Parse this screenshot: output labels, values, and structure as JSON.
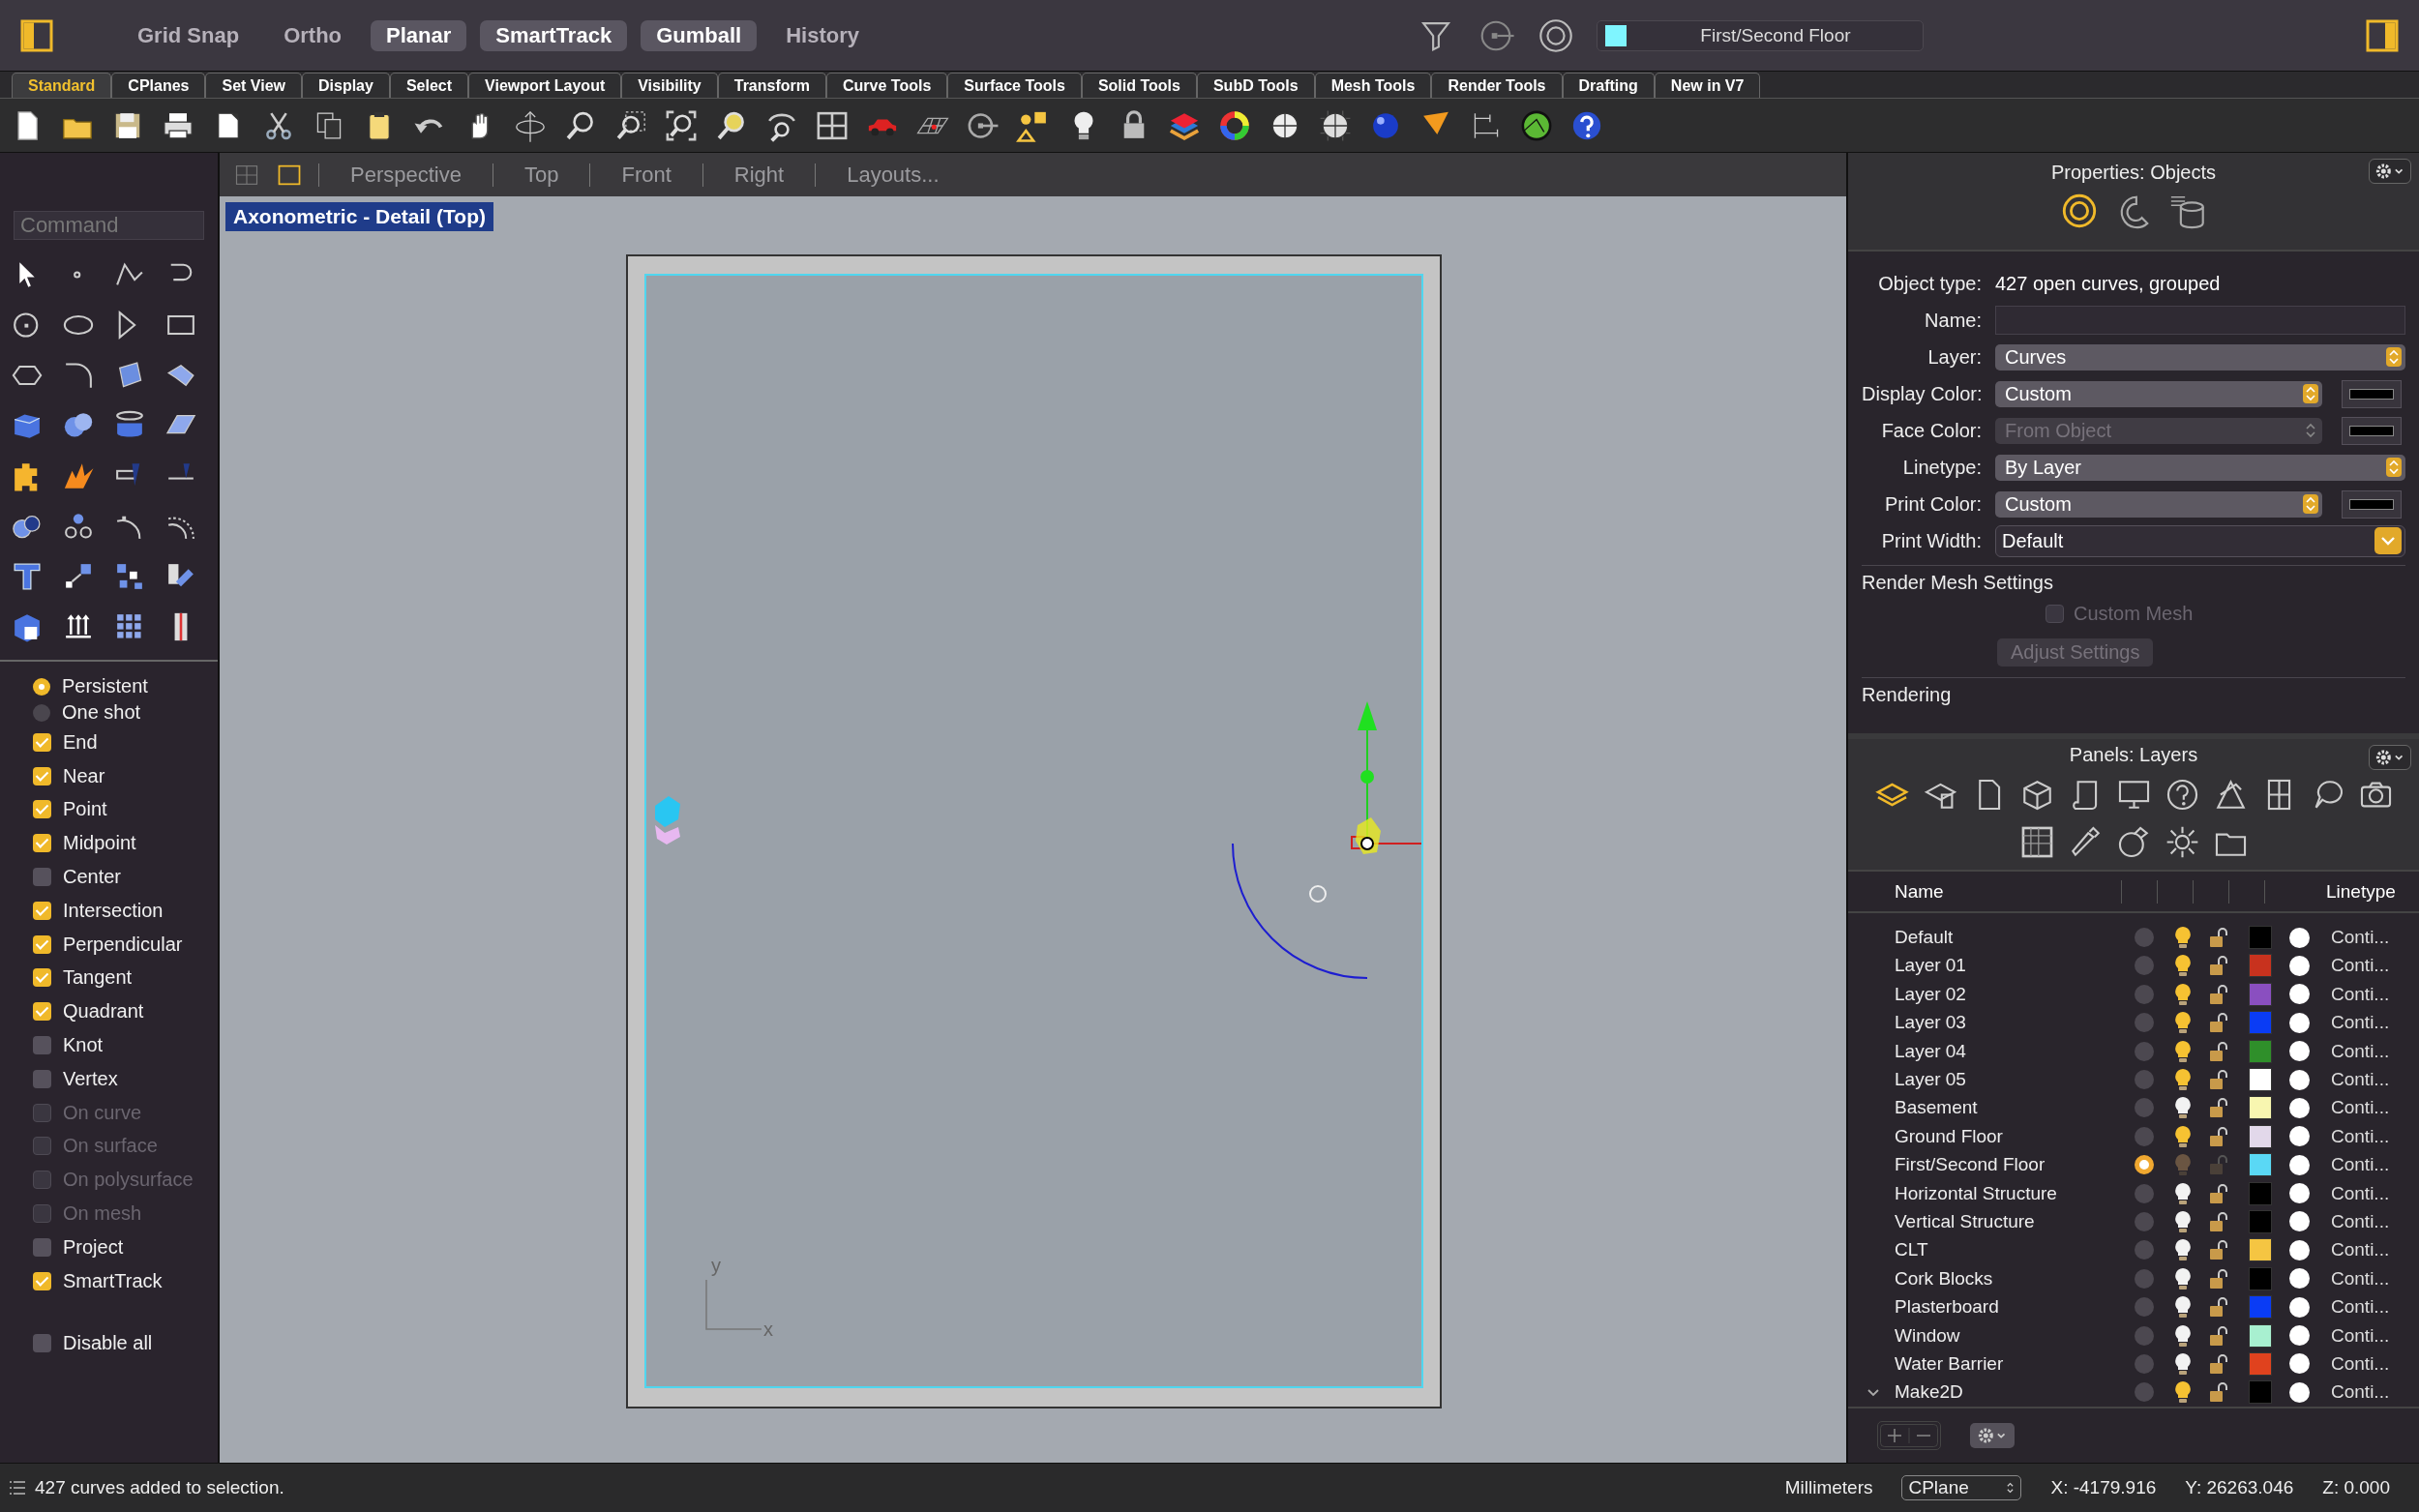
{
  "top_bar": {
    "toggles": [
      {
        "label": "Grid Snap",
        "on": false
      },
      {
        "label": "Ortho",
        "on": false
      },
      {
        "label": "Planar",
        "on": true
      },
      {
        "label": "SmartTrack",
        "on": true
      },
      {
        "label": "Gumball",
        "on": true
      },
      {
        "label": "History",
        "on": false
      }
    ],
    "current_layer": {
      "name": "First/Second Floor",
      "color": "#7ff5ff"
    }
  },
  "toolbar_tabs": [
    {
      "label": "Standard",
      "selected": true
    },
    {
      "label": "CPlanes",
      "selected": false
    },
    {
      "label": "Set View",
      "selected": false
    },
    {
      "label": "Display",
      "selected": false
    },
    {
      "label": "Select",
      "selected": false
    },
    {
      "label": "Viewport Layout",
      "selected": false
    },
    {
      "label": "Visibility",
      "selected": false
    },
    {
      "label": "Transform",
      "selected": false
    },
    {
      "label": "Curve Tools",
      "selected": false
    },
    {
      "label": "Surface Tools",
      "selected": false
    },
    {
      "label": "Solid Tools",
      "selected": false
    },
    {
      "label": "SubD Tools",
      "selected": false
    },
    {
      "label": "Mesh Tools",
      "selected": false
    },
    {
      "label": "Render Tools",
      "selected": false
    },
    {
      "label": "Drafting",
      "selected": false
    },
    {
      "label": "New in V7",
      "selected": false
    }
  ],
  "command": {
    "placeholder": "Command"
  },
  "osnap": {
    "modes": [
      {
        "label": "Persistent",
        "selected": true
      },
      {
        "label": "One shot",
        "selected": false
      }
    ],
    "snaps": [
      {
        "label": "End",
        "checked": true,
        "disabled": false
      },
      {
        "label": "Near",
        "checked": true,
        "disabled": false
      },
      {
        "label": "Point",
        "checked": true,
        "disabled": false
      },
      {
        "label": "Midpoint",
        "checked": true,
        "disabled": false
      },
      {
        "label": "Center",
        "checked": false,
        "disabled": false
      },
      {
        "label": "Intersection",
        "checked": true,
        "disabled": false
      },
      {
        "label": "Perpendicular",
        "checked": true,
        "disabled": false
      },
      {
        "label": "Tangent",
        "checked": true,
        "disabled": false
      },
      {
        "label": "Quadrant",
        "checked": true,
        "disabled": false
      },
      {
        "label": "Knot",
        "checked": false,
        "disabled": false
      },
      {
        "label": "Vertex",
        "checked": false,
        "disabled": false
      },
      {
        "label": "On curve",
        "checked": false,
        "disabled": true
      },
      {
        "label": "On surface",
        "checked": false,
        "disabled": true
      },
      {
        "label": "On polysurface",
        "checked": false,
        "disabled": true
      },
      {
        "label": "On mesh",
        "checked": false,
        "disabled": true
      },
      {
        "label": "Project",
        "checked": false,
        "disabled": false
      },
      {
        "label": "SmartTrack",
        "checked": true,
        "disabled": false
      }
    ],
    "disable_all": {
      "label": "Disable all",
      "checked": false
    }
  },
  "viewport": {
    "tabs": [
      "Perspective",
      "Top",
      "Front",
      "Right",
      "Layouts..."
    ],
    "title": "Axonometric - Detail (Top)",
    "axis": {
      "y": "y",
      "x": "x"
    }
  },
  "properties": {
    "title": "Properties: Objects",
    "object_type": {
      "label": "Object type:",
      "value": "427 open curves, grouped"
    },
    "fields": [
      {
        "kind": "input",
        "label": "Name:"
      },
      {
        "kind": "select",
        "label": "Layer:",
        "value": "Curves",
        "disabled": false,
        "swatch": false
      },
      {
        "kind": "select",
        "label": "Display Color:",
        "value": "Custom",
        "disabled": false,
        "swatch": true
      },
      {
        "kind": "select",
        "label": "Face Color:",
        "value": "From Object",
        "disabled": true,
        "swatch": true
      },
      {
        "kind": "select",
        "label": "Linetype:",
        "value": "By Layer",
        "disabled": false,
        "swatch": false
      },
      {
        "kind": "select",
        "label": "Print Color:",
        "value": "Custom",
        "disabled": false,
        "swatch": true
      },
      {
        "kind": "popup",
        "label": "Print Width:",
        "value": "Default"
      }
    ],
    "render_mesh": {
      "title": "Render Mesh Settings",
      "custom_mesh": {
        "label": "Custom Mesh",
        "checked": false,
        "disabled": true
      },
      "adjust_button": {
        "label": "Adjust Settings",
        "disabled": true
      }
    },
    "next_section": "Rendering"
  },
  "layers": {
    "title": "Panels: Layers",
    "columns": {
      "name": "Name",
      "linetype": "Linetype"
    },
    "rows": [
      {
        "name": "Default",
        "current": false,
        "visible": true,
        "color": "#000000",
        "linetype": "Conti..."
      },
      {
        "name": "Layer 01",
        "current": false,
        "visible": true,
        "color": "#c8321e",
        "linetype": "Conti..."
      },
      {
        "name": "Layer 02",
        "current": false,
        "visible": true,
        "color": "#8a4fc0",
        "linetype": "Conti..."
      },
      {
        "name": "Layer 03",
        "current": false,
        "visible": true,
        "color": "#0a3cf5",
        "linetype": "Conti..."
      },
      {
        "name": "Layer 04",
        "current": false,
        "visible": true,
        "color": "#2f8f2a",
        "linetype": "Conti..."
      },
      {
        "name": "Layer 05",
        "current": false,
        "visible": true,
        "color": "#ffffff",
        "linetype": "Conti..."
      },
      {
        "name": "Basement",
        "current": false,
        "visible": false,
        "color": "#f8f6b0",
        "linetype": "Conti..."
      },
      {
        "name": "Ground Floor",
        "current": false,
        "visible": true,
        "color": "#e2d8ea",
        "linetype": "Conti..."
      },
      {
        "name": "First/Second Floor",
        "current": true,
        "visible": true,
        "color": "#5ad8f5",
        "linetype": "Conti..."
      },
      {
        "name": "Horizontal Structure",
        "current": false,
        "visible": false,
        "color": "#000000",
        "linetype": "Conti..."
      },
      {
        "name": "Vertical Structure",
        "current": false,
        "visible": false,
        "color": "#000000",
        "linetype": "Conti..."
      },
      {
        "name": "CLT",
        "current": false,
        "visible": false,
        "color": "#f5c542",
        "linetype": "Conti..."
      },
      {
        "name": "Cork Blocks",
        "current": false,
        "visible": false,
        "color": "#000000",
        "linetype": "Conti..."
      },
      {
        "name": "Plasterboard",
        "current": false,
        "visible": false,
        "color": "#0a3cf5",
        "linetype": "Conti..."
      },
      {
        "name": "Window",
        "current": false,
        "visible": false,
        "color": "#a8f0d0",
        "linetype": "Conti..."
      },
      {
        "name": "Water Barrier",
        "current": false,
        "visible": false,
        "color": "#e0421e",
        "linetype": "Conti..."
      },
      {
        "name": "Make2D",
        "current": false,
        "visible": true,
        "color": "#000000",
        "linetype": "Conti...",
        "expanded": true
      }
    ]
  },
  "status_bar": {
    "message": "427 curves added to selection.",
    "units": "Millimeters",
    "cplane": "CPlane",
    "x": "X: -4179.916",
    "y": "Y: 26263.046",
    "z": "Z: 0.000"
  }
}
